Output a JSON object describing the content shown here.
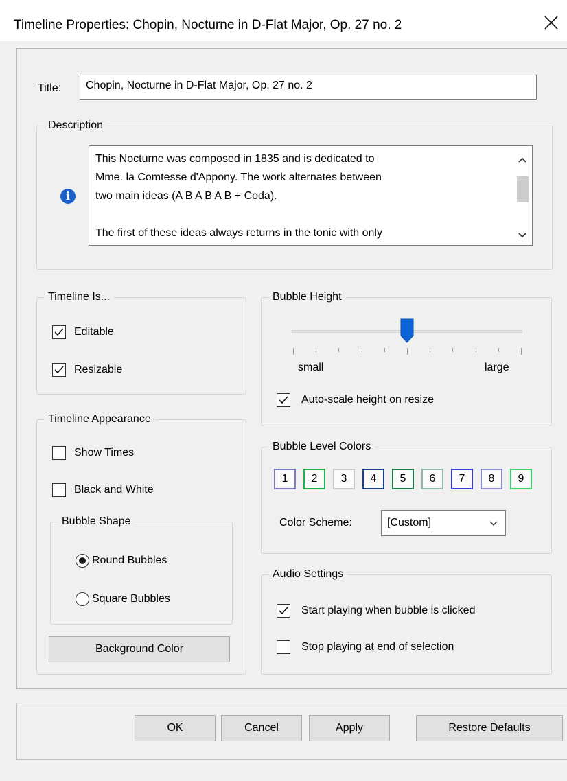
{
  "window": {
    "title": "Timeline Properties: Chopin, Nocturne in D-Flat Major, Op. 27 no. 2"
  },
  "title_field": {
    "label": "Title:",
    "value": "Chopin, Nocturne in D-Flat Major, Op. 27 no. 2"
  },
  "description": {
    "label": "Description",
    "text": "This Nocturne was composed in 1835 and is dedicated to\nMme. la Comtesse d'Appony. The work alternates between\ntwo main ideas (A B A B A B + Coda).\n\nThe first of these ideas always returns in the tonic with only"
  },
  "timeline_is": {
    "label": "Timeline Is...",
    "editable": {
      "label": "Editable",
      "checked": true
    },
    "resizable": {
      "label": "Resizable",
      "checked": true
    }
  },
  "appearance": {
    "label": "Timeline Appearance",
    "show_times": {
      "label": "Show Times",
      "checked": false
    },
    "black_white": {
      "label": "Black and White",
      "checked": false
    },
    "bubble_shape": {
      "label": "Bubble Shape",
      "round": {
        "label": "Round Bubbles",
        "selected": true
      },
      "square": {
        "label": "Square Bubbles",
        "selected": false
      }
    },
    "background_button": "Background Color"
  },
  "bubble_height": {
    "label": "Bubble Height",
    "slider_level": 0.5,
    "min_label": "small",
    "max_label": "large",
    "auto_scale": {
      "label": "Auto-scale height on resize",
      "checked": true
    }
  },
  "level_colors": {
    "label": "Bubble Level Colors",
    "levels": [
      {
        "label": "1",
        "color": "#7b7bbd"
      },
      {
        "label": "2",
        "color": "#22b14c"
      },
      {
        "label": "3",
        "color": "#c8c8c8"
      },
      {
        "label": "4",
        "color": "#1f3d8f"
      },
      {
        "label": "5",
        "color": "#1a7a48"
      },
      {
        "label": "6",
        "color": "#8fb9a4"
      },
      {
        "label": "7",
        "color": "#3a3ad6"
      },
      {
        "label": "8",
        "color": "#8f8fd0"
      },
      {
        "label": "9",
        "color": "#3fcf6a"
      }
    ],
    "scheme_label": "Color Scheme:",
    "scheme_value": "[Custom]"
  },
  "audio": {
    "label": "Audio Settings",
    "start_playing": {
      "label": "Start playing when bubble is clicked",
      "checked": true
    },
    "stop_playing": {
      "label": "Stop playing at end of selection",
      "checked": false
    }
  },
  "buttons": {
    "ok": "OK",
    "cancel": "Cancel",
    "apply": "Apply",
    "restore": "Restore Defaults"
  }
}
